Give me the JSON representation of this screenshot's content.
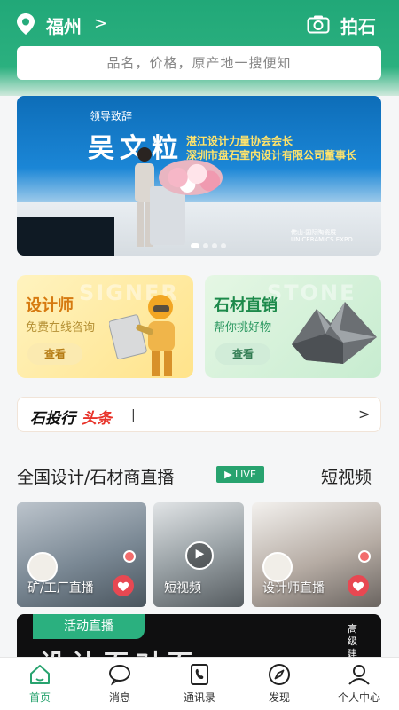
{
  "header": {
    "city": "福州",
    "city_chevron": ">",
    "photo_stone": "拍石",
    "search_placeholder": "品名，价格，原产地一搜便知"
  },
  "banner": {
    "subtitle": "领导致辞",
    "name": "吴文粒",
    "title_line1": "湛江设计力量协会会长",
    "title_line2": "深圳市盘石室内设计有限公司董事长",
    "expo_logo": "佛山·国际陶瓷展 UNICERAMICS EXPO",
    "slide_count": 4,
    "active_slide": 0
  },
  "cards": {
    "designer": {
      "bg_word": "SIGNER",
      "title": "设计师",
      "subtitle": "免费在线咨询",
      "button": "查看"
    },
    "stone": {
      "bg_word": "STONE",
      "title": "石材直销",
      "subtitle": "帮你挑好物",
      "button": "查看"
    }
  },
  "news": {
    "logo_part1": "石投行",
    "logo_part2": "头条",
    "ticker": "|",
    "chevron": ">"
  },
  "live_section": {
    "title": "全国设计/石材商直播",
    "live_badge": "▶ LIVE",
    "right_link": "短视频"
  },
  "videos": [
    {
      "label": "矿/工厂直播",
      "icon": "heart-icon"
    },
    {
      "label": "短视频",
      "icon": "play-icon"
    },
    {
      "label": "设计师直播",
      "icon": "heart-icon"
    }
  ],
  "activity": {
    "tag": "活动直播",
    "headline": "设计面对面",
    "side_text": "高级建"
  },
  "tabs": [
    {
      "label": "首页",
      "icon": "home-icon",
      "active": true
    },
    {
      "label": "消息",
      "icon": "message-icon",
      "active": false
    },
    {
      "label": "通讯录",
      "icon": "contacts-icon",
      "active": false
    },
    {
      "label": "发现",
      "icon": "compass-icon",
      "active": false
    },
    {
      "label": "个人中心",
      "icon": "user-icon",
      "active": false
    }
  ],
  "colors": {
    "brand_green": "#2bb07f",
    "active_tab": "#28a36f",
    "news_red": "#e8332a",
    "heart_red": "#e84852"
  }
}
